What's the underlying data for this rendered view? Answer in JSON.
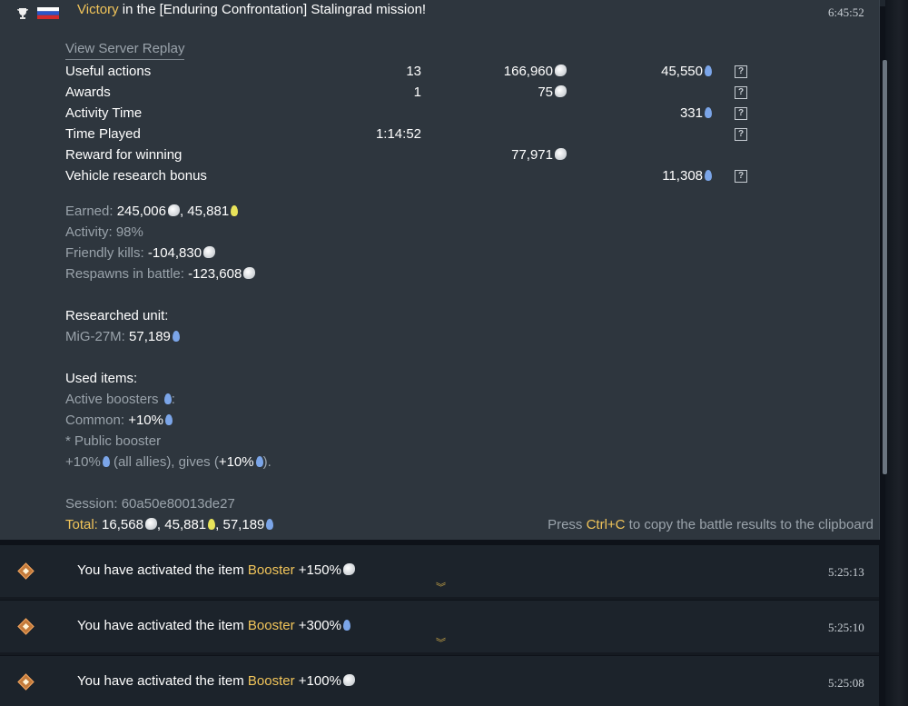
{
  "header": {
    "title_highlight": "Victory",
    "title_rest": " in the [Enduring Confrontation] Stalingrad mission!",
    "time": "6:45:52"
  },
  "replay_link": "View Server Replay",
  "table": {
    "rows": [
      {
        "label": "Useful actions",
        "count": "13",
        "lions": "166,960",
        "rp": "45,550",
        "help": "?"
      },
      {
        "label": "Awards",
        "count": "1",
        "lions": "75",
        "rp": "",
        "help": "?"
      },
      {
        "label": "Activity Time",
        "count": "",
        "lions": "",
        "rp": "331",
        "help": "?"
      },
      {
        "label": "Time Played",
        "count": "1:14:52",
        "lions": "",
        "rp": "",
        "help": "?"
      },
      {
        "label": "Reward for winning",
        "count": "",
        "lions": "77,971",
        "rp": "",
        "help": ""
      },
      {
        "label": "Vehicle research bonus",
        "count": "",
        "lions": "",
        "rp": "11,308",
        "help": "?"
      }
    ]
  },
  "summary": {
    "earned_label": "Earned: ",
    "earned_lions": "245,006",
    "earned_sep": ", ",
    "earned_rp": "45,881",
    "activity_label": "Activity: 98%",
    "friendly_label": "Friendly kills: ",
    "friendly_value": "-104,830",
    "respawns_label": "Respawns in battle: ",
    "respawns_value": "-123,608"
  },
  "research": {
    "heading": "Researched unit:",
    "unit_label": "MiG-27M: ",
    "unit_value": "57,189"
  },
  "items": {
    "heading": "Used items:",
    "active_label": "Active boosters ",
    "active_colon": ":",
    "common_label": "Common: ",
    "common_value": "+10%",
    "public_label": "* Public booster",
    "public_value": "+10%",
    "public_mid": " (all allies), gives (",
    "public_value2": "+10%",
    "public_end": ")."
  },
  "session": "Session: 60a50e80013de27",
  "total": {
    "label": "Total:",
    "lions": "16,568",
    "sep1": ", ",
    "rp_yellow": "45,881",
    "sep2": ", ",
    "rp_blue": "57,189"
  },
  "clipboard": {
    "pre": "Press ",
    "key": "Ctrl+C",
    "post": " to copy the battle results to the clipboard"
  },
  "notifications": [
    {
      "pre": "You have activated the item ",
      "item": "Booster",
      "value": " +150%",
      "currency": "lions",
      "time": "5:25:13"
    },
    {
      "pre": "You have activated the item ",
      "item": "Booster",
      "value": " +300%",
      "currency": "rp",
      "time": "5:25:10"
    },
    {
      "pre": "You have activated the item ",
      "item": "Booster",
      "value": " +100%",
      "currency": "lions",
      "time": "5:25:08"
    }
  ],
  "colors": {
    "accent": "#f2c55a",
    "rp_blue": "#7ba5e8",
    "rp_yellow": "#e8e35a",
    "panel_bg": "#2e363e",
    "row_bg": "#1c232b"
  }
}
